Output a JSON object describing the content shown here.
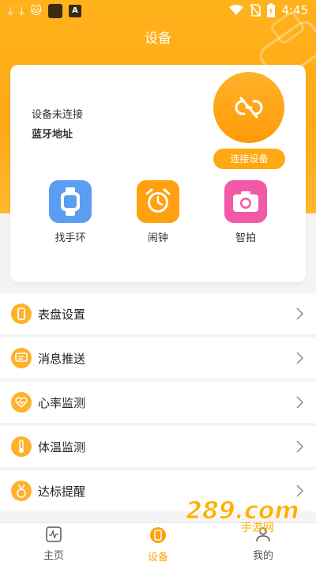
{
  "status_bar": {
    "time": "4:45",
    "app_badge": "A"
  },
  "header": {
    "title": "设备"
  },
  "device_card": {
    "status": "设备未连接",
    "bluetooth_label": "蓝牙地址",
    "connect_button": "连接设备",
    "quick_actions": [
      {
        "label": "找手环",
        "icon": "watch-icon"
      },
      {
        "label": "闹钟",
        "icon": "alarm-clock-icon"
      },
      {
        "label": "智拍",
        "icon": "camera-icon"
      }
    ]
  },
  "menu": {
    "items": [
      {
        "label": "表盘设置",
        "icon": "watch-face-icon"
      },
      {
        "label": "消息推送",
        "icon": "message-icon"
      },
      {
        "label": "心率监测",
        "icon": "heart-rate-icon"
      },
      {
        "label": "体温监测",
        "icon": "thermometer-icon"
      },
      {
        "label": "达标提醒",
        "icon": "medal-icon"
      }
    ]
  },
  "bottom_nav": {
    "items": [
      {
        "label": "主页",
        "icon": "home-chart-icon",
        "active": false
      },
      {
        "label": "设备",
        "icon": "device-watch-icon",
        "active": true
      },
      {
        "label": "我的",
        "icon": "profile-icon",
        "active": false
      }
    ]
  },
  "watermark": {
    "text": "289.com",
    "sub": "手游网"
  },
  "colors": {
    "accent": "#ffa812",
    "watch_blue": "#5a9df2",
    "camera_pink": "#f25aa7"
  }
}
